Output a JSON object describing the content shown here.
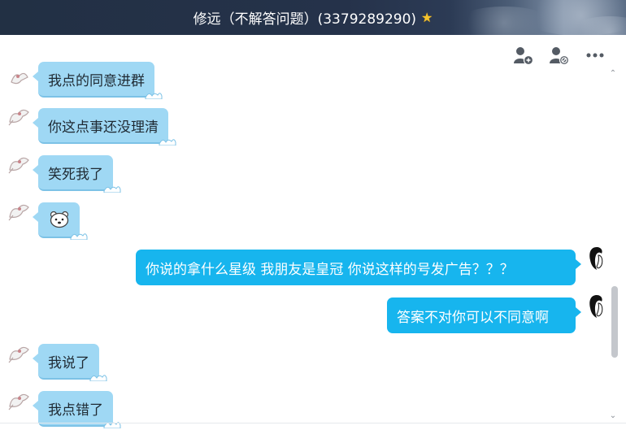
{
  "window": {
    "title": "修远（不解答问题）(3379289290)",
    "title_badge_icon": "star-icon",
    "colors": {
      "titlebar": "#223044",
      "bubble_left": "#9fd8f4",
      "bubble_right": "#17b5ee",
      "star": "#f5c32c"
    }
  },
  "toolbar": {
    "buttons": [
      {
        "name": "add-member-button",
        "icon": "person-add-icon"
      },
      {
        "name": "remove-member-button",
        "icon": "person-block-icon"
      },
      {
        "name": "more-button",
        "icon": "more-dots-icon"
      }
    ]
  },
  "messages": [
    {
      "side": "left",
      "text": "我点的同意进群"
    },
    {
      "side": "left",
      "text": "你这点事还没理清"
    },
    {
      "side": "left",
      "text": "笑死我了"
    },
    {
      "side": "left",
      "emoji": "polar-bear-emoji"
    },
    {
      "side": "right",
      "text": "你说的拿什么星级  我朋友是皇冠  你说这样的号发广告？？？"
    },
    {
      "side": "right",
      "text": "答案不对你可以不同意啊"
    },
    {
      "side": "left",
      "text": "我说了"
    },
    {
      "side": "left",
      "text": "我点错了"
    }
  ]
}
